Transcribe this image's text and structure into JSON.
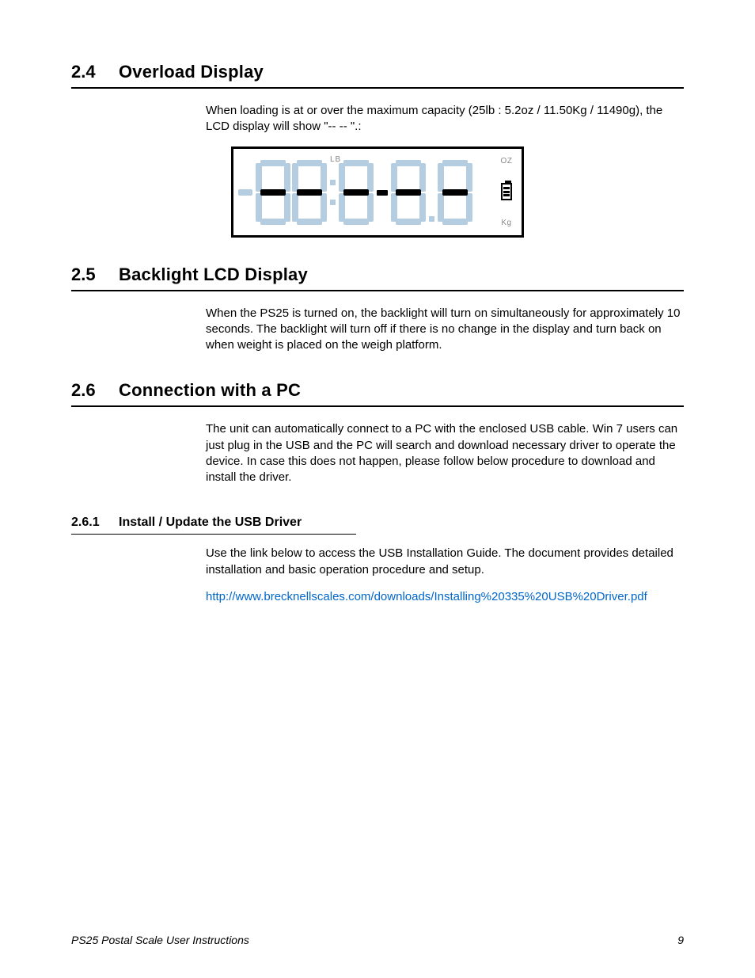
{
  "sections": {
    "s24": {
      "num": "2.4",
      "title": "Overload Display",
      "body": "When loading is at or over the maximum capacity (25lb : 5.2oz / 11.50Kg / 11490g), the LCD display will show \"-- -- \".:"
    },
    "s25": {
      "num": "2.5",
      "title": "Backlight LCD Display",
      "body": "When the PS25 is turned on, the backlight will turn on simultaneously for approximately 10 seconds. The backlight will turn off if there is no change in the display and turn back on when weight is placed on the weigh platform."
    },
    "s26": {
      "num": "2.6",
      "title": "Connection with a PC",
      "body": "The unit can automatically connect to a PC with the enclosed USB cable. Win 7 users can just plug in the USB and the PC will search and download necessary driver to operate the device. In case this does not happen, please follow below procedure to download and install the driver."
    },
    "s261": {
      "num": "2.6.1",
      "title": "Install / Update the USB Driver",
      "body": "Use the link below to access the USB Installation Guide. The document provides detailed installation and basic operation procedure and setup.",
      "link": "http://www.brecknellscales.com/downloads/Installing%20335%20USB%20Driver.pdf"
    }
  },
  "lcd": {
    "unit_lb": "LB",
    "unit_oz": "OZ",
    "unit_kg": "Kg"
  },
  "footer": {
    "left": "PS25 Postal Scale User Instructions",
    "right": "9"
  }
}
